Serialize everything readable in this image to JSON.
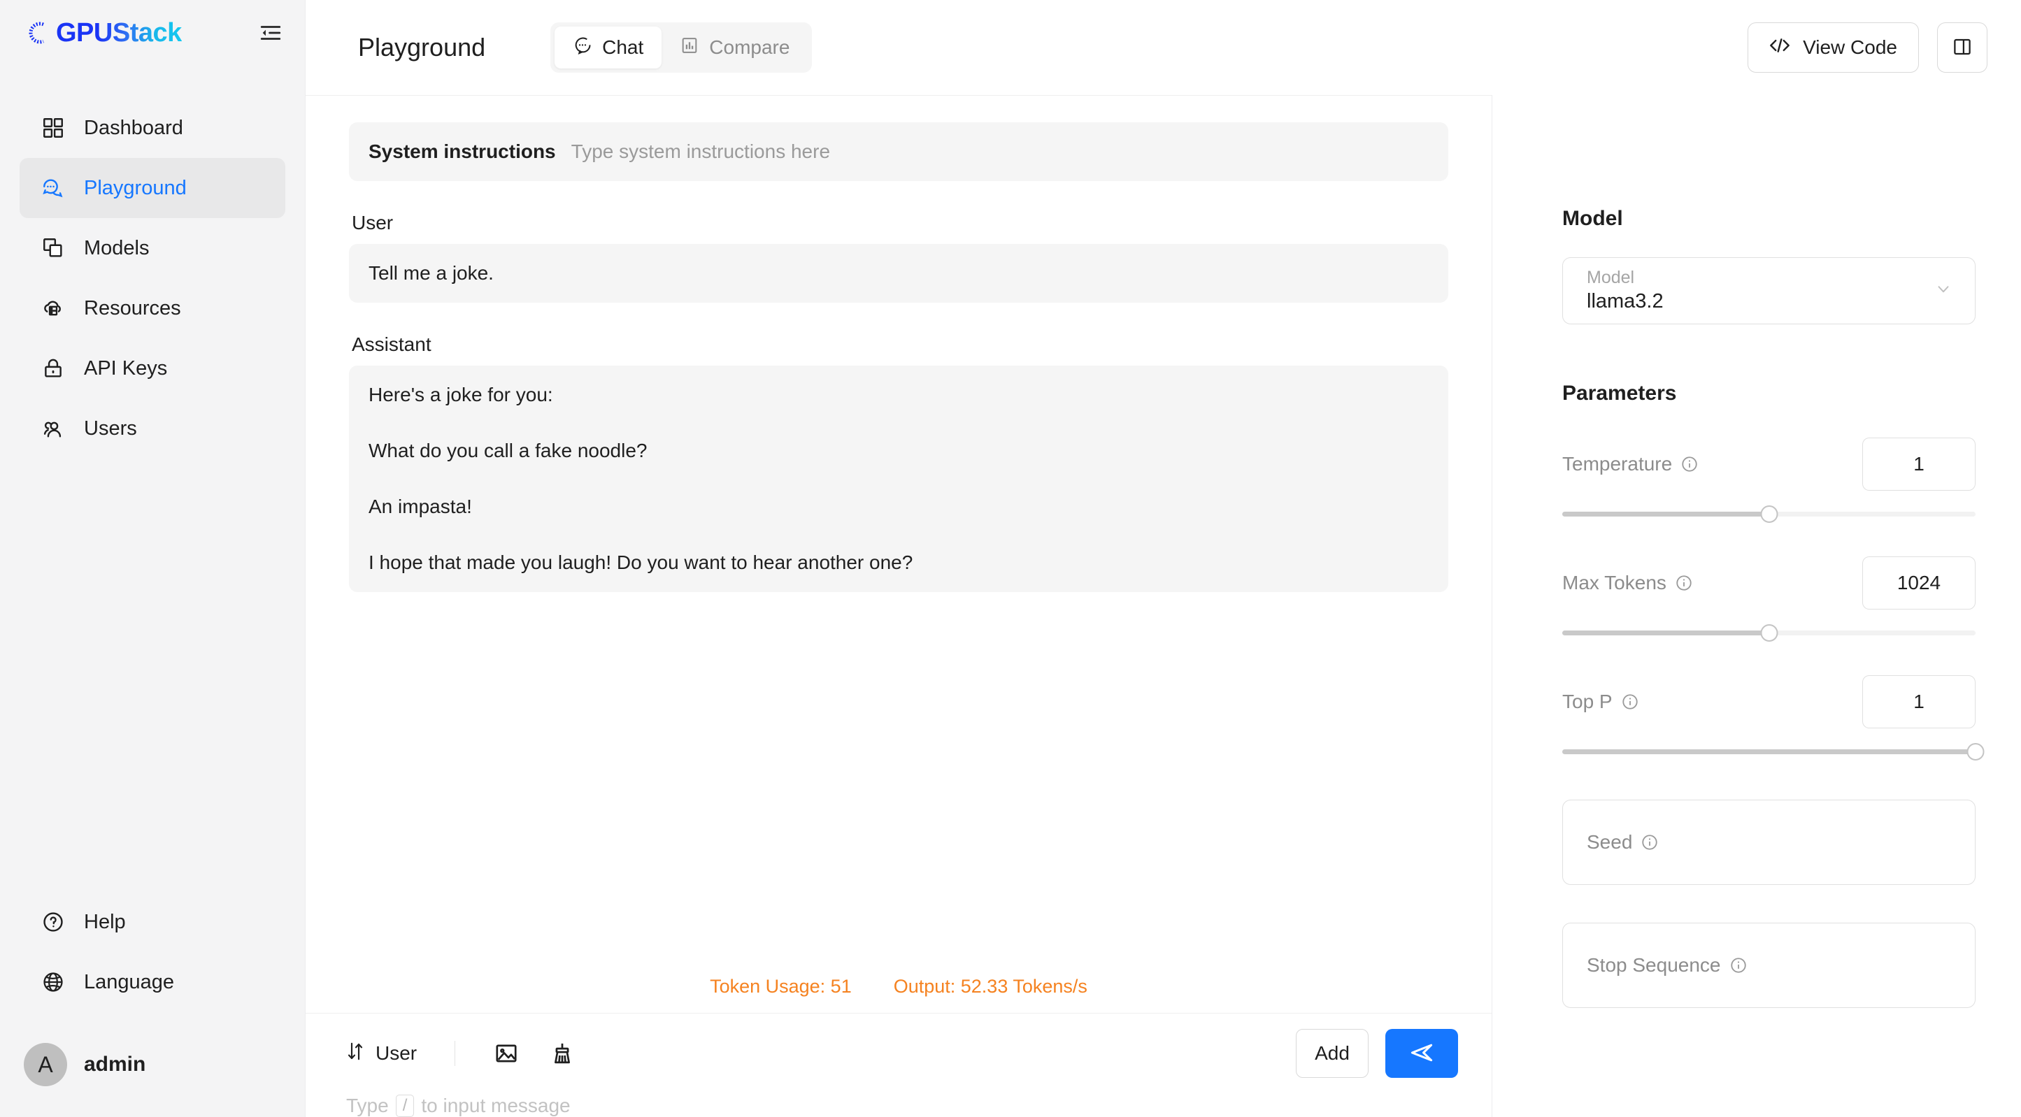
{
  "sidebar": {
    "logo_text": "GPUStack",
    "collapse_icon": "menu-fold-icon",
    "items": [
      {
        "label": "Dashboard",
        "icon": "dashboard-grid-icon",
        "active": false
      },
      {
        "label": "Playground",
        "icon": "chat-bubble-icon",
        "active": true
      },
      {
        "label": "Models",
        "icon": "stacked-squares-icon",
        "active": false
      },
      {
        "label": "Resources",
        "icon": "cloud-server-icon",
        "active": false
      },
      {
        "label": "API Keys",
        "icon": "lock-icon",
        "active": false
      },
      {
        "label": "Users",
        "icon": "users-icon",
        "active": false
      }
    ],
    "bottom_items": [
      {
        "label": "Help",
        "icon": "question-circle-icon"
      },
      {
        "label": "Language",
        "icon": "globe-icon"
      }
    ],
    "account": {
      "avatar_initial": "A",
      "name": "admin"
    }
  },
  "header": {
    "title": "Playground",
    "tabs": [
      {
        "label": "Chat",
        "icon": "chat-dots-icon",
        "active": true
      },
      {
        "label": "Compare",
        "icon": "compare-panels-icon",
        "active": false
      }
    ],
    "view_code_label": "View Code",
    "view_code_icon": "code-brackets-icon",
    "layout_toggle_icon": "split-panel-icon"
  },
  "chat": {
    "system": {
      "label": "System instructions",
      "placeholder": "Type system instructions here",
      "value": ""
    },
    "messages": [
      {
        "role": "User",
        "paragraphs": [
          "Tell me a joke."
        ]
      },
      {
        "role": "Assistant",
        "paragraphs": [
          "Here's a joke for you:",
          "What do you call a fake noodle?",
          "An impasta!",
          "I hope that made you laugh! Do you want to hear another one?"
        ]
      }
    ],
    "usage": {
      "token_usage": "Token Usage: 51",
      "output_rate": "Output: 52.33 Tokens/s",
      "color": "#f58220"
    }
  },
  "composer": {
    "role_selector": "User",
    "role_swap_icon": "swap-arrows-icon",
    "image_icon": "image-icon",
    "clear_icon": "broom-icon",
    "input_placeholder_prefix": "Type",
    "input_slash_key": "/",
    "input_placeholder_suffix": "to input message",
    "input_value": "",
    "add_label": "Add",
    "send_icon": "send-plane-icon",
    "send_color": "#1677ff"
  },
  "right_panel": {
    "model_section_title": "Model",
    "model_field": {
      "label": "Model",
      "value": "llama3.2",
      "chevron_icon": "chevron-down-icon"
    },
    "parameters_title": "Parameters",
    "parameters": [
      {
        "name": "Temperature",
        "value": "1",
        "slider_percent": 50,
        "info_icon": "info-circle-icon"
      },
      {
        "name": "Max Tokens",
        "value": "1024",
        "slider_percent": 50,
        "info_icon": "info-circle-icon"
      },
      {
        "name": "Top P",
        "value": "1",
        "slider_percent": 100,
        "info_icon": "info-circle-icon"
      }
    ],
    "text_fields": [
      {
        "label": "Seed",
        "value": "",
        "info_icon": "info-circle-icon"
      },
      {
        "label": "Stop Sequence",
        "value": "",
        "info_icon": "info-circle-icon"
      }
    ]
  }
}
